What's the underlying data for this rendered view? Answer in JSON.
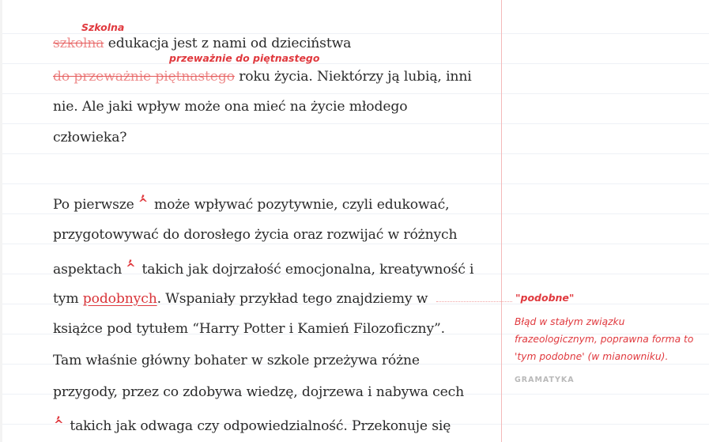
{
  "essay": {
    "p1": {
      "l1_strike": "szkolna",
      "l1_corr": "Szkolna",
      "l1_rest": " edukacja jest z nami od dzieciństwa",
      "l2_strike": "do przeważnie piętnastego",
      "l2_corr": "przeważnie do piętnastego",
      "l2_rest": " roku życia. Niektórzy ją lubią, inni",
      "l3": "nie. Ale jaki wpływ może ona mieć na życie młodego",
      "l4": "człowieka?"
    },
    "p2": {
      "l1a": "Po pierwsze",
      "l1b": " może wpływać pozytywnie, czyli edukować,",
      "l2": "przygotowywać do dorosłego życia oraz rozwijać w różnych",
      "l3a": "aspektach",
      "l3b": " takich jak dojrzałość emocjonalna, kreatywność i",
      "l4a": "tym ",
      "l4_err": "podobnych",
      "l4b": ". Wspaniały przykład tego znajdziemy w",
      "l5": "książce pod tytułem “Harry Potter i Kamień Filozoficzny”.",
      "l6": "Tam właśnie główny bohater w szkole przeżywa różne",
      "l7": "przygody, przez co zdobywa wiedzę, dojrzewa i nabywa cech",
      "l8b": " takich jak odwaga czy odpowiedzialność. Przekonuje się"
    },
    "caret": {
      "mark": "^",
      "comma": ","
    }
  },
  "annotation": {
    "title": "\"podobne\"",
    "body": "Błąd w stałym związku frazeologicznym, poprawna forma to 'tym podobne' (w mianowniku).",
    "tag": "GRAMATYKA"
  },
  "colors": {
    "accent": "#e0393e",
    "strike": "#ee8a8a",
    "margin_line": "#f4b9b9",
    "text": "#2a2a2a",
    "tag": "#b9b9b9"
  }
}
